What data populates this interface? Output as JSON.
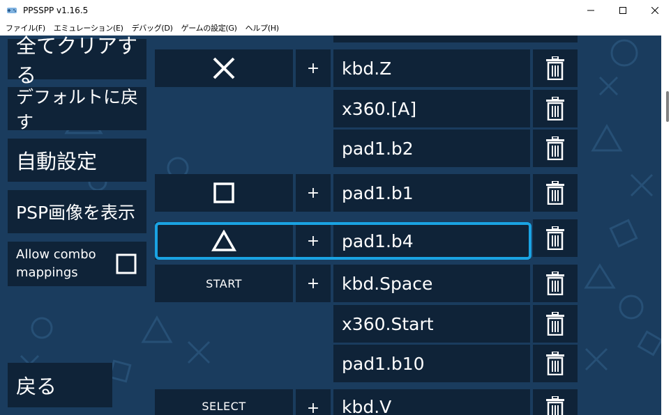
{
  "window": {
    "title": "PPSSPP v1.16.5"
  },
  "menu": [
    {
      "label": "ファイル(F)"
    },
    {
      "label": "エミュレーション(E)"
    },
    {
      "label": "デバッグ(D)"
    },
    {
      "label": "ゲームの設定(G)"
    },
    {
      "label": "ヘルプ(H)"
    }
  ],
  "left_buttons": {
    "clear_all": "全てクリアする",
    "reset_default": "デフォルトに戻す",
    "auto_config": "自動設定",
    "show_psp": "PSP画像を表示",
    "allow_combo": "Allow combo mappings",
    "back": "戻る"
  },
  "plus_label": "+",
  "key_labels": {
    "start": "START",
    "select": "SELECT"
  },
  "mappings": {
    "cross": [
      "kbd.Z",
      "x360.[A]",
      "pad1.b2"
    ],
    "square": [
      "pad1.b1"
    ],
    "triangle": [
      "pad1.b4"
    ],
    "start": [
      "kbd.Space",
      "x360.Start",
      "pad1.b10"
    ],
    "select": [
      "kbd.V"
    ]
  },
  "colors": {
    "background": "#1a3c5e",
    "panel": "#0f2338",
    "focus": "#1aa3e3"
  },
  "icons": {
    "trash": "trash-icon",
    "cross": "cross-icon",
    "square": "square-icon",
    "triangle": "triangle-icon"
  }
}
